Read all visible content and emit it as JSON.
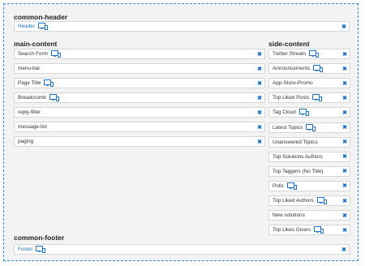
{
  "sections": {
    "common_header": {
      "title": "common-header",
      "items": [
        {
          "label": "Header",
          "has_device_icon": true,
          "style": "blue"
        }
      ]
    },
    "main_content": {
      "title": "main-content",
      "items": [
        {
          "label": "Search Form",
          "has_device_icon": true
        },
        {
          "label": "menu-bar",
          "has_device_icon": false
        },
        {
          "label": "Page Title",
          "has_device_icon": true
        },
        {
          "label": "Breadcrumb",
          "has_device_icon": true
        },
        {
          "label": "reply-filter",
          "has_device_icon": false
        },
        {
          "label": "message-list",
          "has_device_icon": false
        },
        {
          "label": "paging",
          "has_device_icon": false
        }
      ]
    },
    "side_content": {
      "title": "side-content",
      "items": [
        {
          "label": "Twitter Stream",
          "has_device_icon": true
        },
        {
          "label": "Announcements",
          "has_device_icon": true
        },
        {
          "label": "App-Store-Promo",
          "has_device_icon": false
        },
        {
          "label": "Top Liked Posts",
          "has_device_icon": true
        },
        {
          "label": "Tag Cloud",
          "has_device_icon": true
        },
        {
          "label": "Latest Topics",
          "has_device_icon": true
        },
        {
          "label": "Unanswered Topics",
          "has_device_icon": false
        },
        {
          "label": "Top Solutions Authors",
          "has_device_icon": false
        },
        {
          "label": "Top Taggers (No Title)",
          "has_device_icon": false
        },
        {
          "label": "Polls",
          "has_device_icon": true
        },
        {
          "label": "Top Liked Authors",
          "has_device_icon": true
        },
        {
          "label": "New solutions",
          "has_device_icon": false
        },
        {
          "label": "Top Likes Givers",
          "has_device_icon": true
        }
      ]
    },
    "common_footer": {
      "title": "common-footer",
      "items": [
        {
          "label": "Footer",
          "has_device_icon": true,
          "style": "blue"
        }
      ]
    }
  },
  "icons": {
    "device": "desktop-mobile-icon",
    "close": "close-icon"
  },
  "colors": {
    "accent": "#1a73c4",
    "border": "#2a8fd6",
    "panel": "#f3f3f3"
  }
}
